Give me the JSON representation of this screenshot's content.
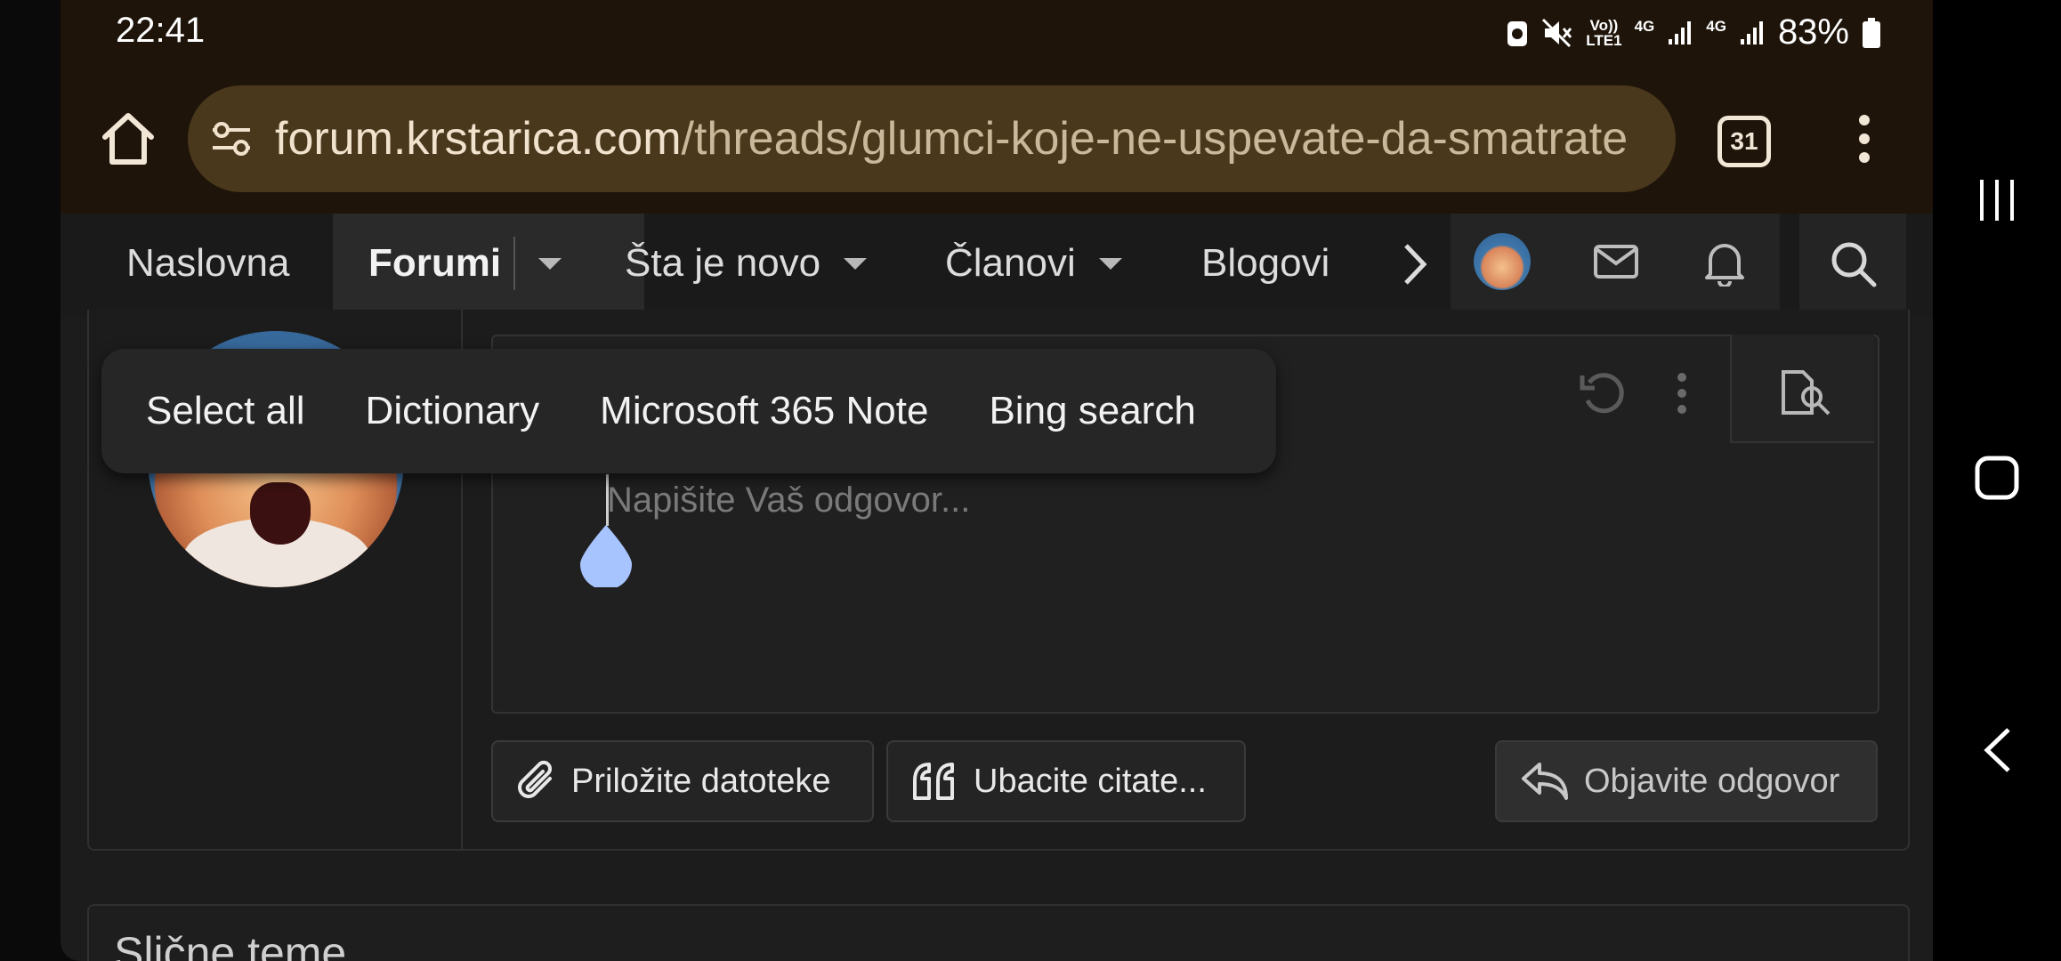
{
  "status_bar": {
    "time": "22:41",
    "volte": "Vo))",
    "lte": "LTE1",
    "net1": "4G",
    "net2": "4G",
    "battery": "83%"
  },
  "browser": {
    "url_domain": "forum.krstarica.com",
    "url_path": "/threads/glumci-koje-ne-uspevate-da-smatrate",
    "tab_count": "31"
  },
  "site_nav": {
    "items": [
      {
        "label": "Naslovna"
      },
      {
        "label": "Forumi"
      },
      {
        "label": "Šta je novo"
      },
      {
        "label": "Članovi"
      },
      {
        "label": "Blogovi"
      }
    ]
  },
  "context_menu": {
    "items": [
      {
        "label": "Select all"
      },
      {
        "label": "Dictionary"
      },
      {
        "label": "Microsoft 365 Note"
      },
      {
        "label": "Bing search"
      }
    ]
  },
  "editor": {
    "placeholder": "Napišite Vaš odgovor..."
  },
  "actions": {
    "attach_label": "Priložite datoteke",
    "quote_label": "Ubacite citate...",
    "submit_label": "Objavite odgovor"
  },
  "similar": {
    "title": "Slične teme"
  },
  "colors": {
    "browser_bg": "#1e140a",
    "url_pill": "#4a381c",
    "page_bg": "#1c1c1c",
    "handle": "#a8c4ff"
  }
}
